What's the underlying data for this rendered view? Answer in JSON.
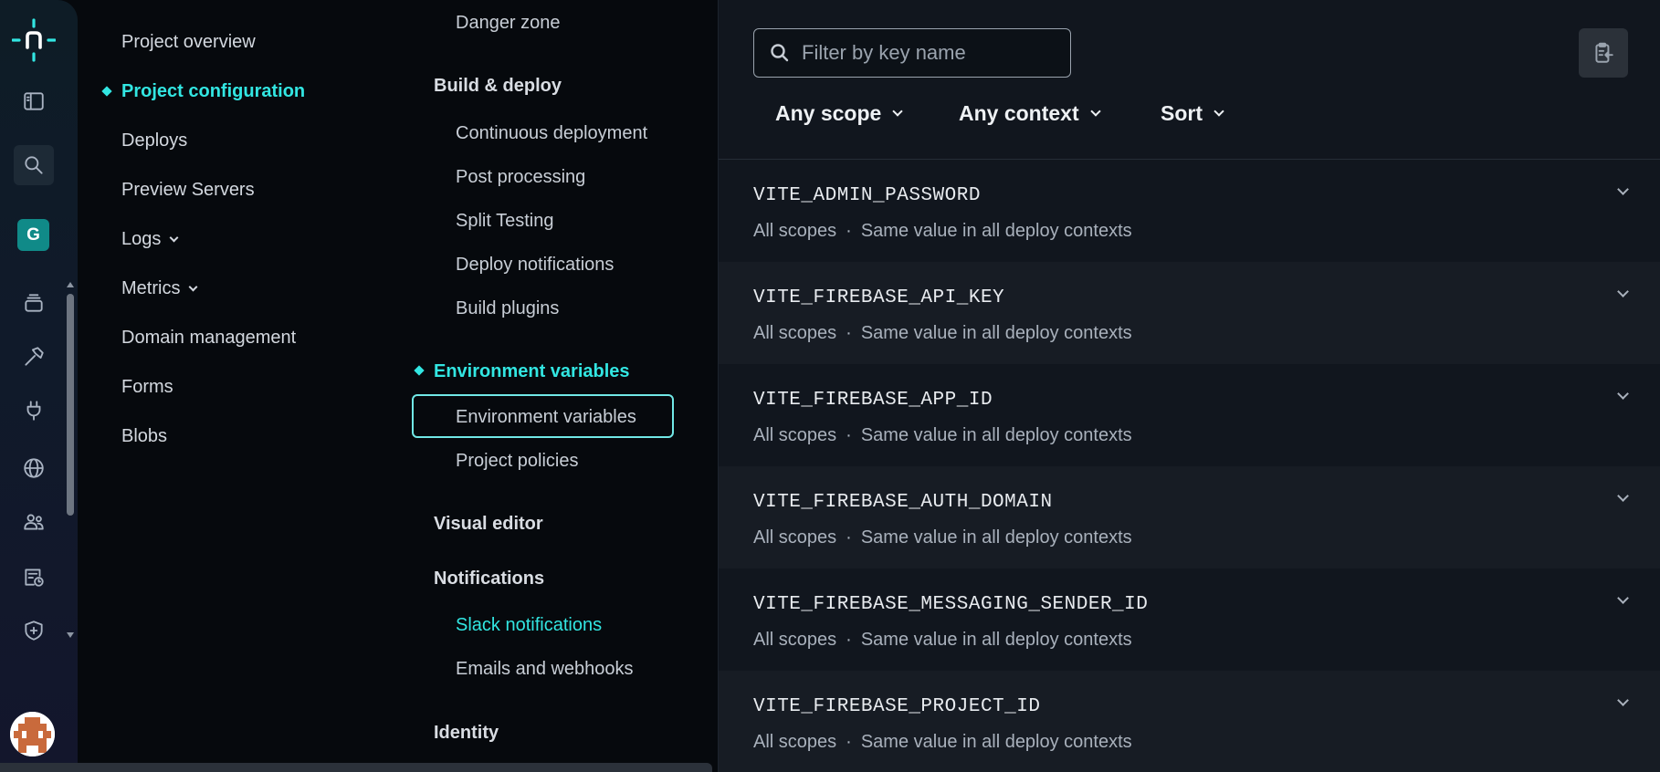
{
  "rail": {
    "team_initial": "G",
    "icons": [
      "netlify-logo-icon",
      "sidebar-toggle-icon",
      "search-icon",
      "team-icon",
      "projects-stack-icon",
      "builds-hammer-icon",
      "integrations-plug-icon",
      "domains-globe-icon",
      "members-icon",
      "billing-icon",
      "security-shield-icon",
      "user-avatar"
    ]
  },
  "nav": {
    "items": [
      {
        "label": "Project overview"
      },
      {
        "label": "Project configuration"
      },
      {
        "label": "Deploys"
      },
      {
        "label": "Preview Servers"
      },
      {
        "label": "Logs"
      },
      {
        "label": "Metrics"
      },
      {
        "label": "Domain management"
      },
      {
        "label": "Forms"
      },
      {
        "label": "Blobs"
      }
    ]
  },
  "subnav": {
    "danger_zone": "Danger zone",
    "build_deploy": "Build & deploy",
    "build_items": [
      "Continuous deployment",
      "Post processing",
      "Split Testing",
      "Deploy notifications",
      "Build plugins"
    ],
    "env_head": "Environment variables",
    "env_items": [
      "Environment variables",
      "Project policies"
    ],
    "visual_editor": "Visual editor",
    "notifications": "Notifications",
    "notification_items": [
      "Slack notifications",
      "Emails and webhooks"
    ],
    "identity": "Identity"
  },
  "toolbar": {
    "search_placeholder": "Filter by key name",
    "filters": [
      "Any scope",
      "Any context",
      "Sort"
    ]
  },
  "variables": [
    {
      "key": "VITE_ADMIN_PASSWORD",
      "scope": "All scopes",
      "sep": "·",
      "context": "Same value in all deploy contexts"
    },
    {
      "key": "VITE_FIREBASE_API_KEY",
      "scope": "All scopes",
      "sep": "·",
      "context": "Same value in all deploy contexts"
    },
    {
      "key": "VITE_FIREBASE_APP_ID",
      "scope": "All scopes",
      "sep": "·",
      "context": "Same value in all deploy contexts"
    },
    {
      "key": "VITE_FIREBASE_AUTH_DOMAIN",
      "scope": "All scopes",
      "sep": "·",
      "context": "Same value in all deploy contexts"
    },
    {
      "key": "VITE_FIREBASE_MESSAGING_SENDER_ID",
      "scope": "All scopes",
      "sep": "·",
      "context": "Same value in all deploy contexts"
    },
    {
      "key": "VITE_FIREBASE_PROJECT_ID",
      "scope": "All scopes",
      "sep": "·",
      "context": "Same value in all deploy contexts"
    }
  ],
  "colors": {
    "accent": "#32e6e2",
    "team_badge": "#108a88"
  }
}
